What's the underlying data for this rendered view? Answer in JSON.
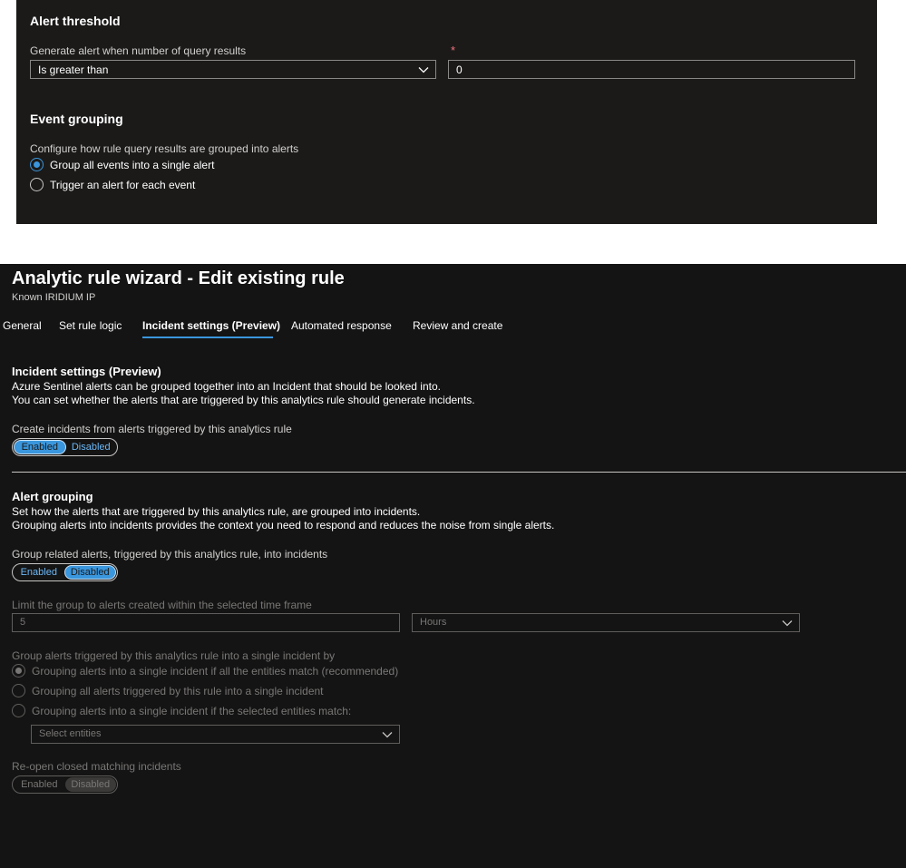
{
  "alert_threshold": {
    "title": "Alert threshold",
    "label": "Generate alert when number of query results",
    "required_mark": "*",
    "operator": "Is greater than",
    "value": "0"
  },
  "event_grouping": {
    "title": "Event grouping",
    "label": "Configure how rule query results are grouped into alerts",
    "options": [
      {
        "label": "Group all events into a single alert",
        "selected": true
      },
      {
        "label": "Trigger an alert for each event",
        "selected": false
      }
    ]
  },
  "wizard": {
    "title": "Analytic rule wizard - Edit existing rule",
    "subtitle": "Known IRIDIUM IP",
    "tabs": [
      {
        "label": "General"
      },
      {
        "label": "Set rule logic"
      },
      {
        "label": "Incident settings (Preview)",
        "active": true
      },
      {
        "label": "Automated response"
      },
      {
        "label": "Review and create"
      }
    ]
  },
  "incident_settings": {
    "title": "Incident settings (Preview)",
    "desc1": "Azure Sentinel alerts can be grouped together into an Incident that should be looked into.",
    "desc2": "You can set whether the alerts that are triggered by this analytics rule should generate incidents.",
    "create_label": "Create incidents from alerts triggered by this analytics rule",
    "toggle": {
      "enabled": "Enabled",
      "disabled": "Disabled",
      "value": "Enabled"
    }
  },
  "alert_grouping": {
    "title": "Alert grouping",
    "desc1": "Set how the alerts that are triggered by this analytics rule, are grouped into incidents.",
    "desc2": "Grouping alerts into incidents provides the context you need to respond and reduces the noise from single alerts.",
    "group_label": "Group related alerts, triggered by this analytics rule, into incidents",
    "toggle": {
      "enabled": "Enabled",
      "disabled": "Disabled",
      "value": "Disabled"
    },
    "limit_label": "Limit the group to alerts created within the selected time frame",
    "limit_value": "5",
    "limit_unit": "Hours",
    "group_by_label": "Group alerts triggered by this analytics rule into a single incident by",
    "group_by_options": [
      {
        "label": "Grouping alerts into a single incident if all the entities match (recommended)",
        "selected": true
      },
      {
        "label": "Grouping all alerts triggered by this rule into a single incident",
        "selected": false
      },
      {
        "label": "Grouping alerts into a single incident if the selected entities match:",
        "selected": false
      }
    ],
    "entities_placeholder": "Select entities",
    "reopen_label": "Re-open closed matching incidents",
    "reopen_toggle": {
      "enabled": "Enabled",
      "disabled": "Disabled",
      "value": "Disabled"
    }
  },
  "colors": {
    "accent": "#3a96dd",
    "panel_top": "#1b1a19",
    "panel_bottom": "#141414"
  }
}
